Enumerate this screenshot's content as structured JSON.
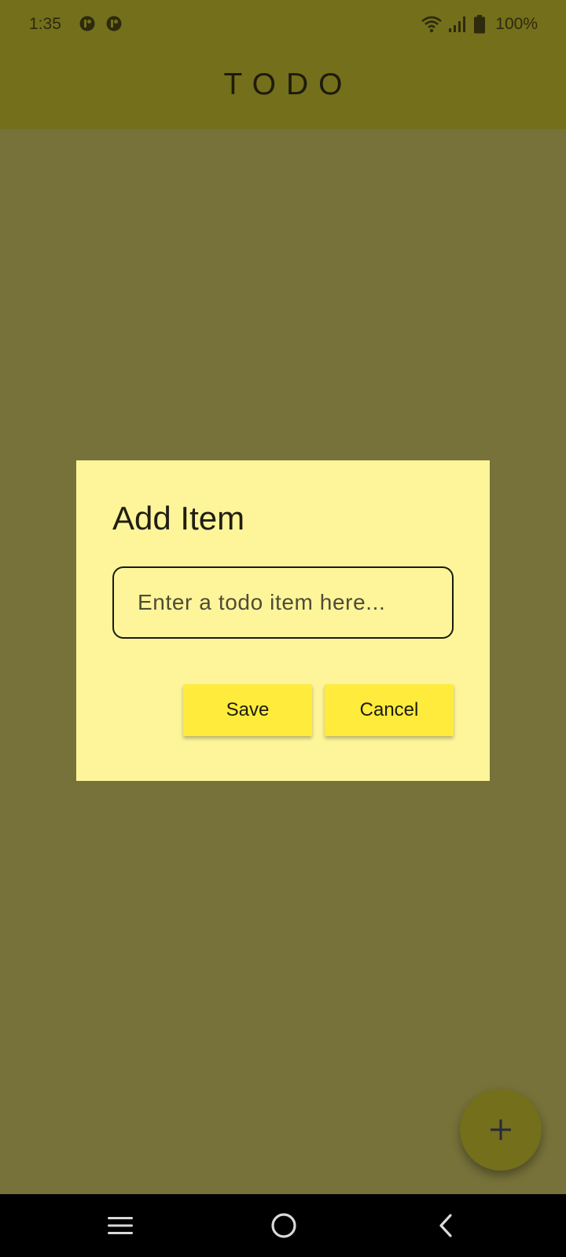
{
  "status_bar": {
    "time": "1:35",
    "battery_text": "100%",
    "icons": [
      "notification-app-icon",
      "notification-app-icon",
      "wifi-icon",
      "signal-icon",
      "battery-icon"
    ]
  },
  "app_bar": {
    "title": "TODO"
  },
  "dialog": {
    "title": "Add Item",
    "input_placeholder": "Enter a todo item here...",
    "input_value": "",
    "save_label": "Save",
    "cancel_label": "Cancel"
  },
  "fab": {
    "icon": "plus-icon"
  },
  "nav_bar": {
    "icons": [
      "menu-icon",
      "home-icon",
      "back-icon"
    ]
  },
  "colors": {
    "app_bar": "#746f1a",
    "scrim_background": "#77723a",
    "dialog_background": "#fef59a",
    "button_background": "#ffeb3b",
    "nav_bar": "#000000"
  }
}
